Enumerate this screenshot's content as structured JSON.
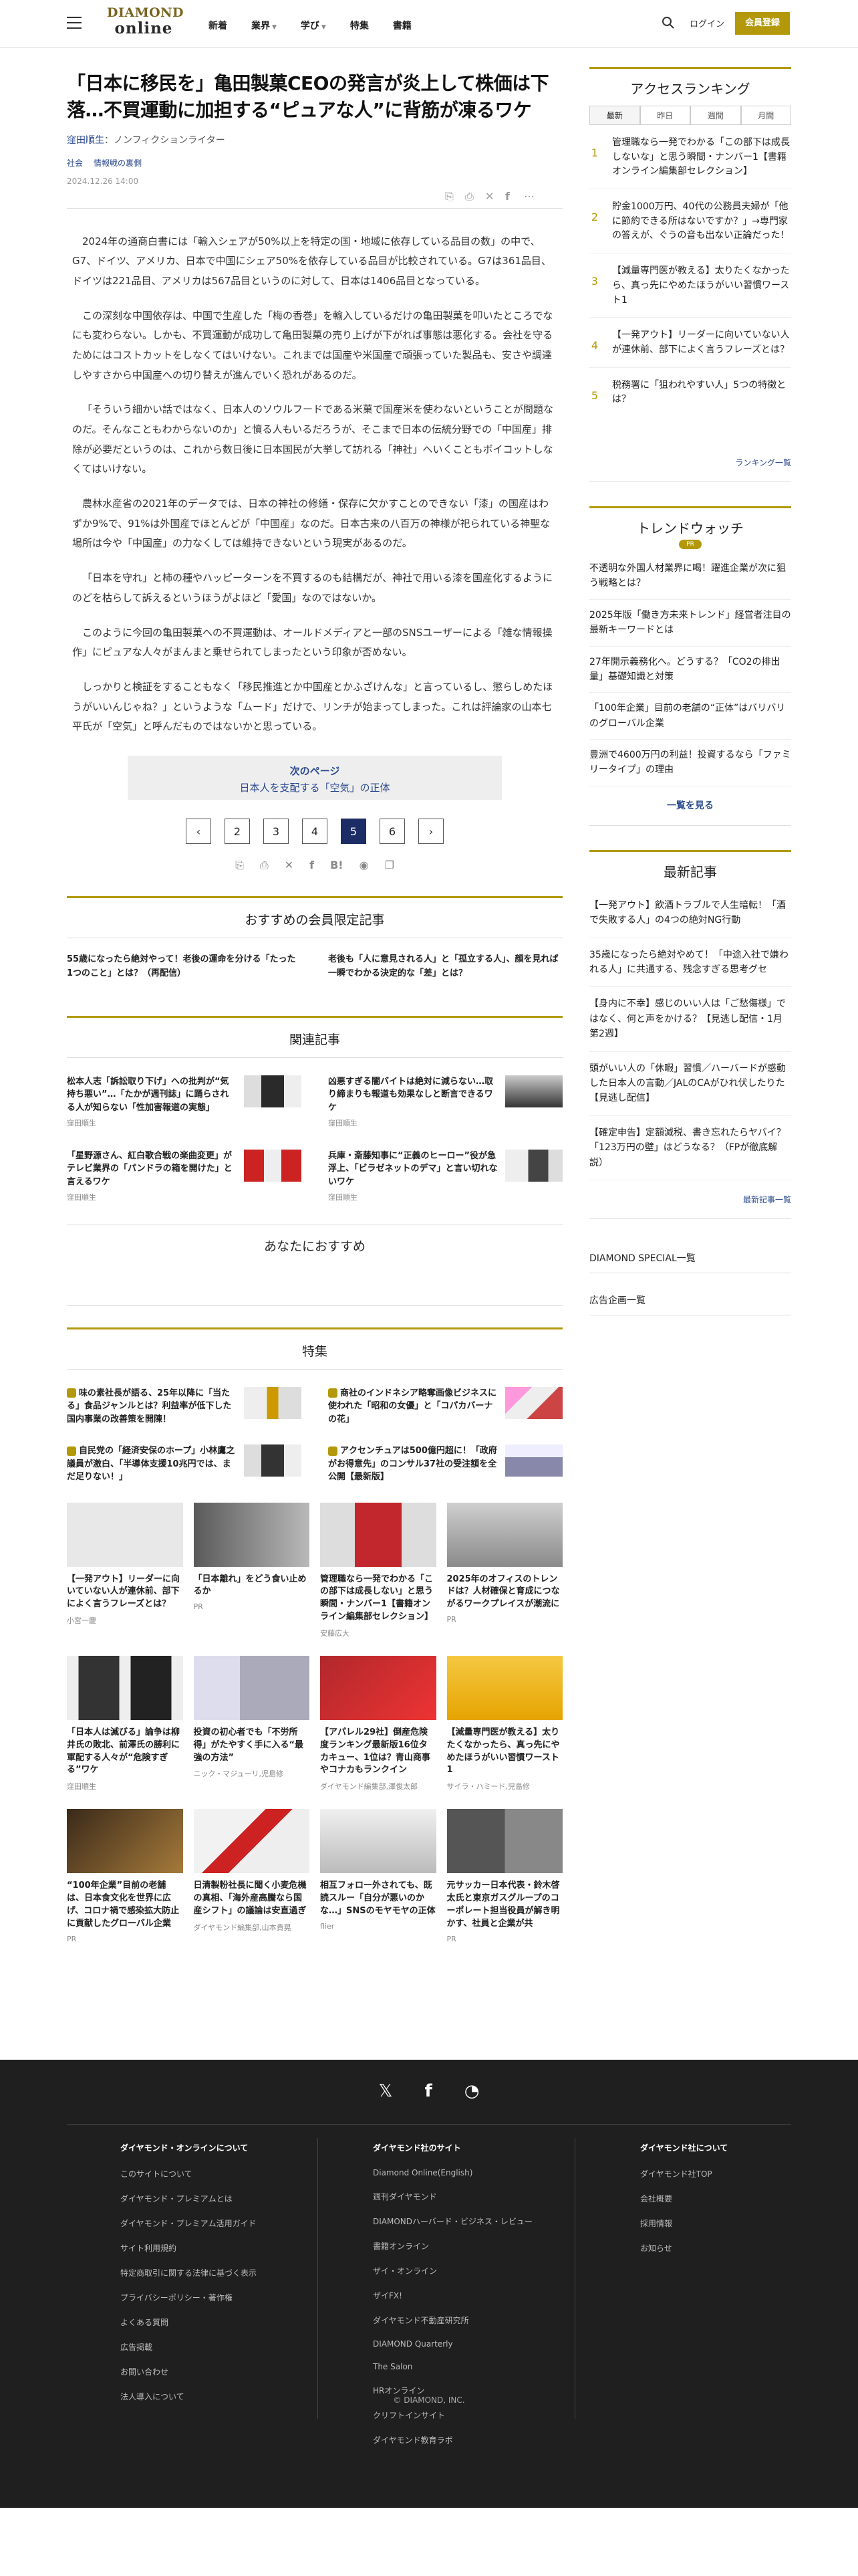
{
  "header": {
    "logo_top": "DIAMOND",
    "logo_bottom": "online",
    "nav": [
      "新着",
      "業界",
      "学び",
      "特集",
      "書籍"
    ],
    "login": "ログイン",
    "register": "会員登録"
  },
  "article": {
    "title": "「日本に移民を」亀田製菓CEOの発言が炎上して株価は下落…不買運動に加担する“ピュアな人”に背筋が凍るワケ",
    "author": "窪田順生",
    "author_role": "：ノンフィクションライター",
    "categories": [
      "社会",
      "情報戦の裏側"
    ],
    "date": "2024.12.26 14:00",
    "paragraphs": [
      "2024年の通商白書には「輸入シェアが50%以上を特定の国・地域に依存している品目の数」の中で、G7、ドイツ、アメリカ、日本で中国にシェア50%を依存している品目が比較されている。G7は361品目、ドイツは221品目、アメリカは567品目というのに対して、日本は1406品目となっている。",
      "この深刻な中国依存は、中国で生産した「梅の香巻」を輸入しているだけの亀田製菓を叩いたところでなにも変わらない。しかも、不買運動が成功して亀田製菓の売り上げが下がれば事態は悪化する。会社を守るためにはコストカットをしなくてはいけない。これまでは国産や米国産で頑張っていた製品も、安さや調達しやすさから中国産への切り替えが進んでいく恐れがあるのだ。",
      "「そういう細かい話ではなく、日本人のソウルフードである米菓で国産米を使わないということが問題なのだ。そんなこともわからないのか」と憤る人もいるだろうが、そこまで日本の伝統分野での「中国産」排除が必要だというのは、これから数日後に日本国民が大挙して訪れる「神社」へいくこともボイコットしなくてはいけない。",
      "農林水産省の2021年のデータでは、日本の神社の修繕・保存に欠かすことのできない「漆」の国産はわずか9%で、91%は外国産でほとんどが「中国産」なのだ。日本古来の八百万の神様が祀られている神聖な場所は今や「中国産」の力なくしては維持できないという現実があるのだ。",
      "「日本を守れ」と柿の種やハッピーターンを不買するのも結構だが、神社で用いる漆を国産化するようにのどを枯らして訴えるというほうがよほど「愛国」なのではないか。",
      "このように今回の亀田製菓への不買運動は、オールドメディアと一部のSNSユーザーによる「雑な情報操作」にピュアな人々がまんまと乗せられてしまったという印象が否めない。",
      "しっかりと検証をすることもなく「移民推進とか中国産とかふざけんな」と言っているし、懲らしめたほうがいいんじゃね？」というような「ムード」だけで、リンチが始まってしまった。これは評論家の山本七平氏が「空気」と呼んだものではないかと思っている。"
    ],
    "next_label": "次のページ",
    "next_title": "日本人を支配する「空気」の正体",
    "pages": [
      "2",
      "3",
      "4",
      "5",
      "6"
    ],
    "current_page": "5"
  },
  "recommend": {
    "heading": "おすすめの会員限定記事",
    "items": [
      "55歳になったら絶対やって！老後の運命を分ける「たった1つのこと」とは？（再配信）",
      "老後も「人に意見される人」と「孤立する人」、顔を見れば一瞬でわかる決定的な「差」とは？"
    ]
  },
  "related": {
    "heading": "関連記事",
    "items": [
      {
        "title": "松本人志「訴訟取り下げ」への批判が“気持ち悪い”…「たかが週刊誌」に踊らされる人が知らない「性加害報道の実態」",
        "author": "窪田順生"
      },
      {
        "title": "凶悪すぎる闇バイトは絶対に減らない…取り締まりも報道も効果なしと断言できるワケ",
        "author": "窪田順生"
      },
      {
        "title": "「星野源さん、紅白歌合戦の楽曲変更」がテレビ業界の「パンドラの箱を開けた」と言えるワケ",
        "author": "窪田順生"
      },
      {
        "title": "兵庫・斎藤知事に“正義のヒーロー”役が急浮上、「ビラゼネットのデマ」と言い切れないワケ",
        "author": "窪田順生"
      }
    ]
  },
  "for_you": {
    "heading": "あなたにおすすめ"
  },
  "special": {
    "heading": "特集",
    "items": [
      "味の素社長が語る、25年以降に「当たる」食品ジャンルとは？利益率が低下した国内事業の改善策を開陳！",
      "商社のインドネシア略奪画像ビジネスに使われた「昭和の女優」と「コパカバーナの花」",
      "自民党の「経済安保のホープ」小林鷹之議員が激白、「半導体支援10兆円では、まだ足りない！」",
      "アクセンチュアは500億円超に！「政府がお得意先」のコンサル37社の受注額を全公開【最新版】"
    ]
  },
  "cards": [
    {
      "title": "【一発アウト】リーダーに向いていない人が連休前、部下によく言うフレーズとは？",
      "author": "小宮一慶"
    },
    {
      "title": "「日本離れ」をどう食い止めるか",
      "author": "PR"
    },
    {
      "title": "管理職なら一発でわかる「この部下は成長しない」と思う瞬間・ナンバー1【書籍オンライン編集部セレクション】",
      "author": "安藤広大"
    },
    {
      "title": "2025年のオフィスのトレンドは？人材確保と育成につながるワークプレイスが潮流に",
      "author": "PR"
    },
    {
      "title": "「日本人は滅びる」論争は柳井氏の敗北、前澤氏の勝利に軍配する人々が“危険すぎる”ワケ",
      "author": "窪田順生"
    },
    {
      "title": "投資の初心者でも「不労所得」がたやすく手に入る“最強の方法”",
      "author": "ニック・マジューリ,児島修"
    },
    {
      "title": "【アパレル29社】倒産危険度ランキング最新版16位タカキュー、1位は？青山商事やコナカもランクイン",
      "author": "ダイヤモンド編集部,澤俊太郎"
    },
    {
      "title": "【減量専門医が教える】太りたくなかったら、真っ先にやめたほうがいい習慣ワースト1",
      "author": "サイラ・ハミード,児島修"
    },
    {
      "title": "“100年企業”目前の老舗は、日本食文化を世界に広げ、コロナ禍で感染拡大防止に貢献したグローバル企業",
      "author": "PR"
    },
    {
      "title": "日清製粉社長に聞く小麦危機の真相、「海外産高騰なら国産シフト」の議論は安直過ぎ",
      "author": "ダイヤモンド編集部,山本貴晃"
    },
    {
      "title": "相互フォロー外されても、既読スルー「自分が悪いのかな…」SNSのモヤモヤの正体",
      "author": "flier"
    },
    {
      "title": "元サッカー日本代表・鈴木啓太氏と東京ガスグループのコーポレート担当役員が解き明かす、社員と企業が共",
      "author": "PR"
    }
  ],
  "sidebar": {
    "ranking_heading": "アクセスランキング",
    "ranking_tabs": [
      "最新",
      "昨日",
      "週間",
      "月間"
    ],
    "ranking": [
      "管理職なら一発でわかる「この部下は成長しないな」と思う瞬間・ナンバー1【書籍オンライン編集部セレクション】",
      "貯金1000万円、40代の公務員夫婦が「他に節約できる所はないですか？」→専門家の答えが、ぐうの音も出ない正論だった！",
      "【減量専門医が教える】太りたくなかったら、真っ先にやめたほうがいい習慣ワースト1",
      "【一発アウト】リーダーに向いていない人が連休前、部下によく言うフレーズとは？",
      "税務署に「狙われやすい人」5つの特徴とは？"
    ],
    "ranking_more": "ランキング一覧",
    "trend_heading": "トレンドウォッチ",
    "trend_badge": "PR",
    "trend": [
      "不透明な外国人材業界に喝！躍進企業が次に狙う戦略とは？",
      "2025年版「働き方未来トレンド」経営者注目の最新キーワードとは",
      "27年開示義務化へ。どうする？「CO2の排出量」基礎知識と対策",
      "「100年企業」目前の老舗の“正体”はバリバリのグローバル企業",
      "豊洲で4600万円の利益！投資するなら「ファミリータイプ」の理由"
    ],
    "trend_more": "一覧を見る",
    "latest_heading": "最新記事",
    "latest": [
      "【一発アウト】飲酒トラブルで人生暗転！「酒で失敗する人」の4つの絶対NG行動",
      "35歳になったら絶対やめて！「中途入社で嫌われる人」に共通する、残念すぎる思考グセ",
      "【身内に不幸】感じのいい人は「ご愁傷様」ではなく、何と声をかける？【見逃し配信・1月第2週】",
      "頭がいい人の「休暇」習慣／ハーバードが感動した日本人の言動／JALのCAがひれ伏したりた【見逃し配信】",
      "【確定申告】定額減税、書き忘れたらヤバイ？「123万円の壁」はどうなる？（FPが徹底解説）"
    ],
    "latest_more": "最新記事一覧",
    "links": [
      "DIAMOND SPECIAL一覧",
      "広告企画一覧"
    ]
  },
  "footer": {
    "col1_heading": "ダイヤモンド・オンラインについて",
    "col1": [
      "このサイトについて",
      "ダイヤモンド・プレミアムとは",
      "ダイヤモンド・プレミアム活用ガイド",
      "サイト利用規約",
      "特定商取引に関する法律に基づく表示",
      "プライバシーポリシー・著作権",
      "よくある質問",
      "広告掲載",
      "お問い合わせ",
      "法人導入について"
    ],
    "col2_heading": "ダイヤモンド社のサイト",
    "col2": [
      "Diamond Online(English)",
      "週刊ダイヤモンド",
      "DIAMONDハーバード・ビジネス・レビュー",
      "書籍オンライン",
      "ザイ・オンライン",
      "ザイFX!",
      "ダイヤモンド不動産研究所",
      "DIAMOND Quarterly",
      "The Salon",
      "HRオンライン",
      "クリフトインサイト",
      "ダイヤモンド教育ラボ"
    ],
    "col3_heading": "ダイヤモンド社について",
    "col3": [
      "ダイヤモンド社TOP",
      "会社概要",
      "採用情報",
      "お知らせ"
    ],
    "copyright": "© DIAMOND, INC."
  }
}
